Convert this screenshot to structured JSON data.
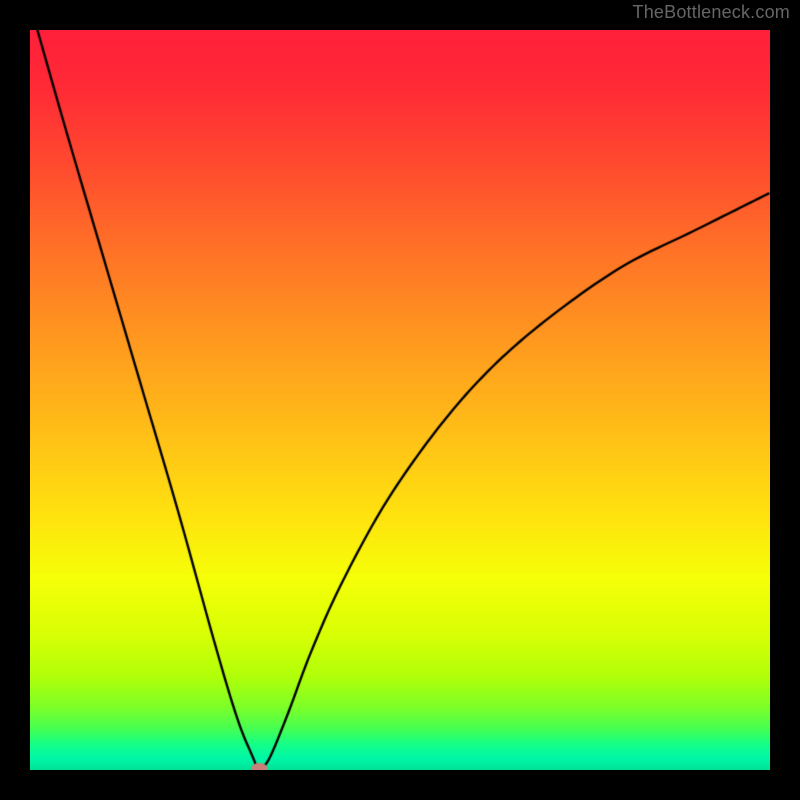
{
  "watermark": "TheBottleneck.com",
  "chart_data": {
    "type": "line",
    "title": "",
    "xlabel": "",
    "ylabel": "",
    "xlim": [
      0,
      100
    ],
    "ylim": [
      0,
      100
    ],
    "background": "rainbow-gradient",
    "grid": false,
    "legend": false,
    "series": [
      {
        "name": "curve",
        "color": "#000000",
        "x": [
          1,
          5,
          10,
          15,
          20,
          25,
          28,
          30,
          31,
          32,
          33,
          35,
          38,
          42,
          48,
          55,
          62,
          70,
          80,
          90,
          100
        ],
        "y": [
          100,
          86,
          69,
          52,
          35,
          17,
          7,
          2,
          0,
          1,
          3,
          8,
          16,
          25,
          36,
          46,
          54,
          61,
          68,
          73,
          78
        ]
      }
    ],
    "marker": {
      "name": "optimum-point",
      "x": 31,
      "y": 0,
      "color": "#c98078",
      "rx": 8,
      "ry": 5
    },
    "gradient_stops": [
      {
        "t": 0.0,
        "color": "#ff1f3a"
      },
      {
        "t": 0.08,
        "color": "#ff2b36"
      },
      {
        "t": 0.18,
        "color": "#ff4a2f"
      },
      {
        "t": 0.3,
        "color": "#ff7327"
      },
      {
        "t": 0.42,
        "color": "#ff991f"
      },
      {
        "t": 0.55,
        "color": "#ffc117"
      },
      {
        "t": 0.66,
        "color": "#ffe40f"
      },
      {
        "t": 0.74,
        "color": "#f6ff08"
      },
      {
        "t": 0.815,
        "color": "#d9ff05"
      },
      {
        "t": 0.875,
        "color": "#b0ff0a"
      },
      {
        "t": 0.915,
        "color": "#7dff28"
      },
      {
        "t": 0.945,
        "color": "#45ff55"
      },
      {
        "t": 0.965,
        "color": "#15ff88"
      },
      {
        "t": 0.985,
        "color": "#00f7a8"
      },
      {
        "t": 1.0,
        "color": "#00e197"
      }
    ]
  }
}
